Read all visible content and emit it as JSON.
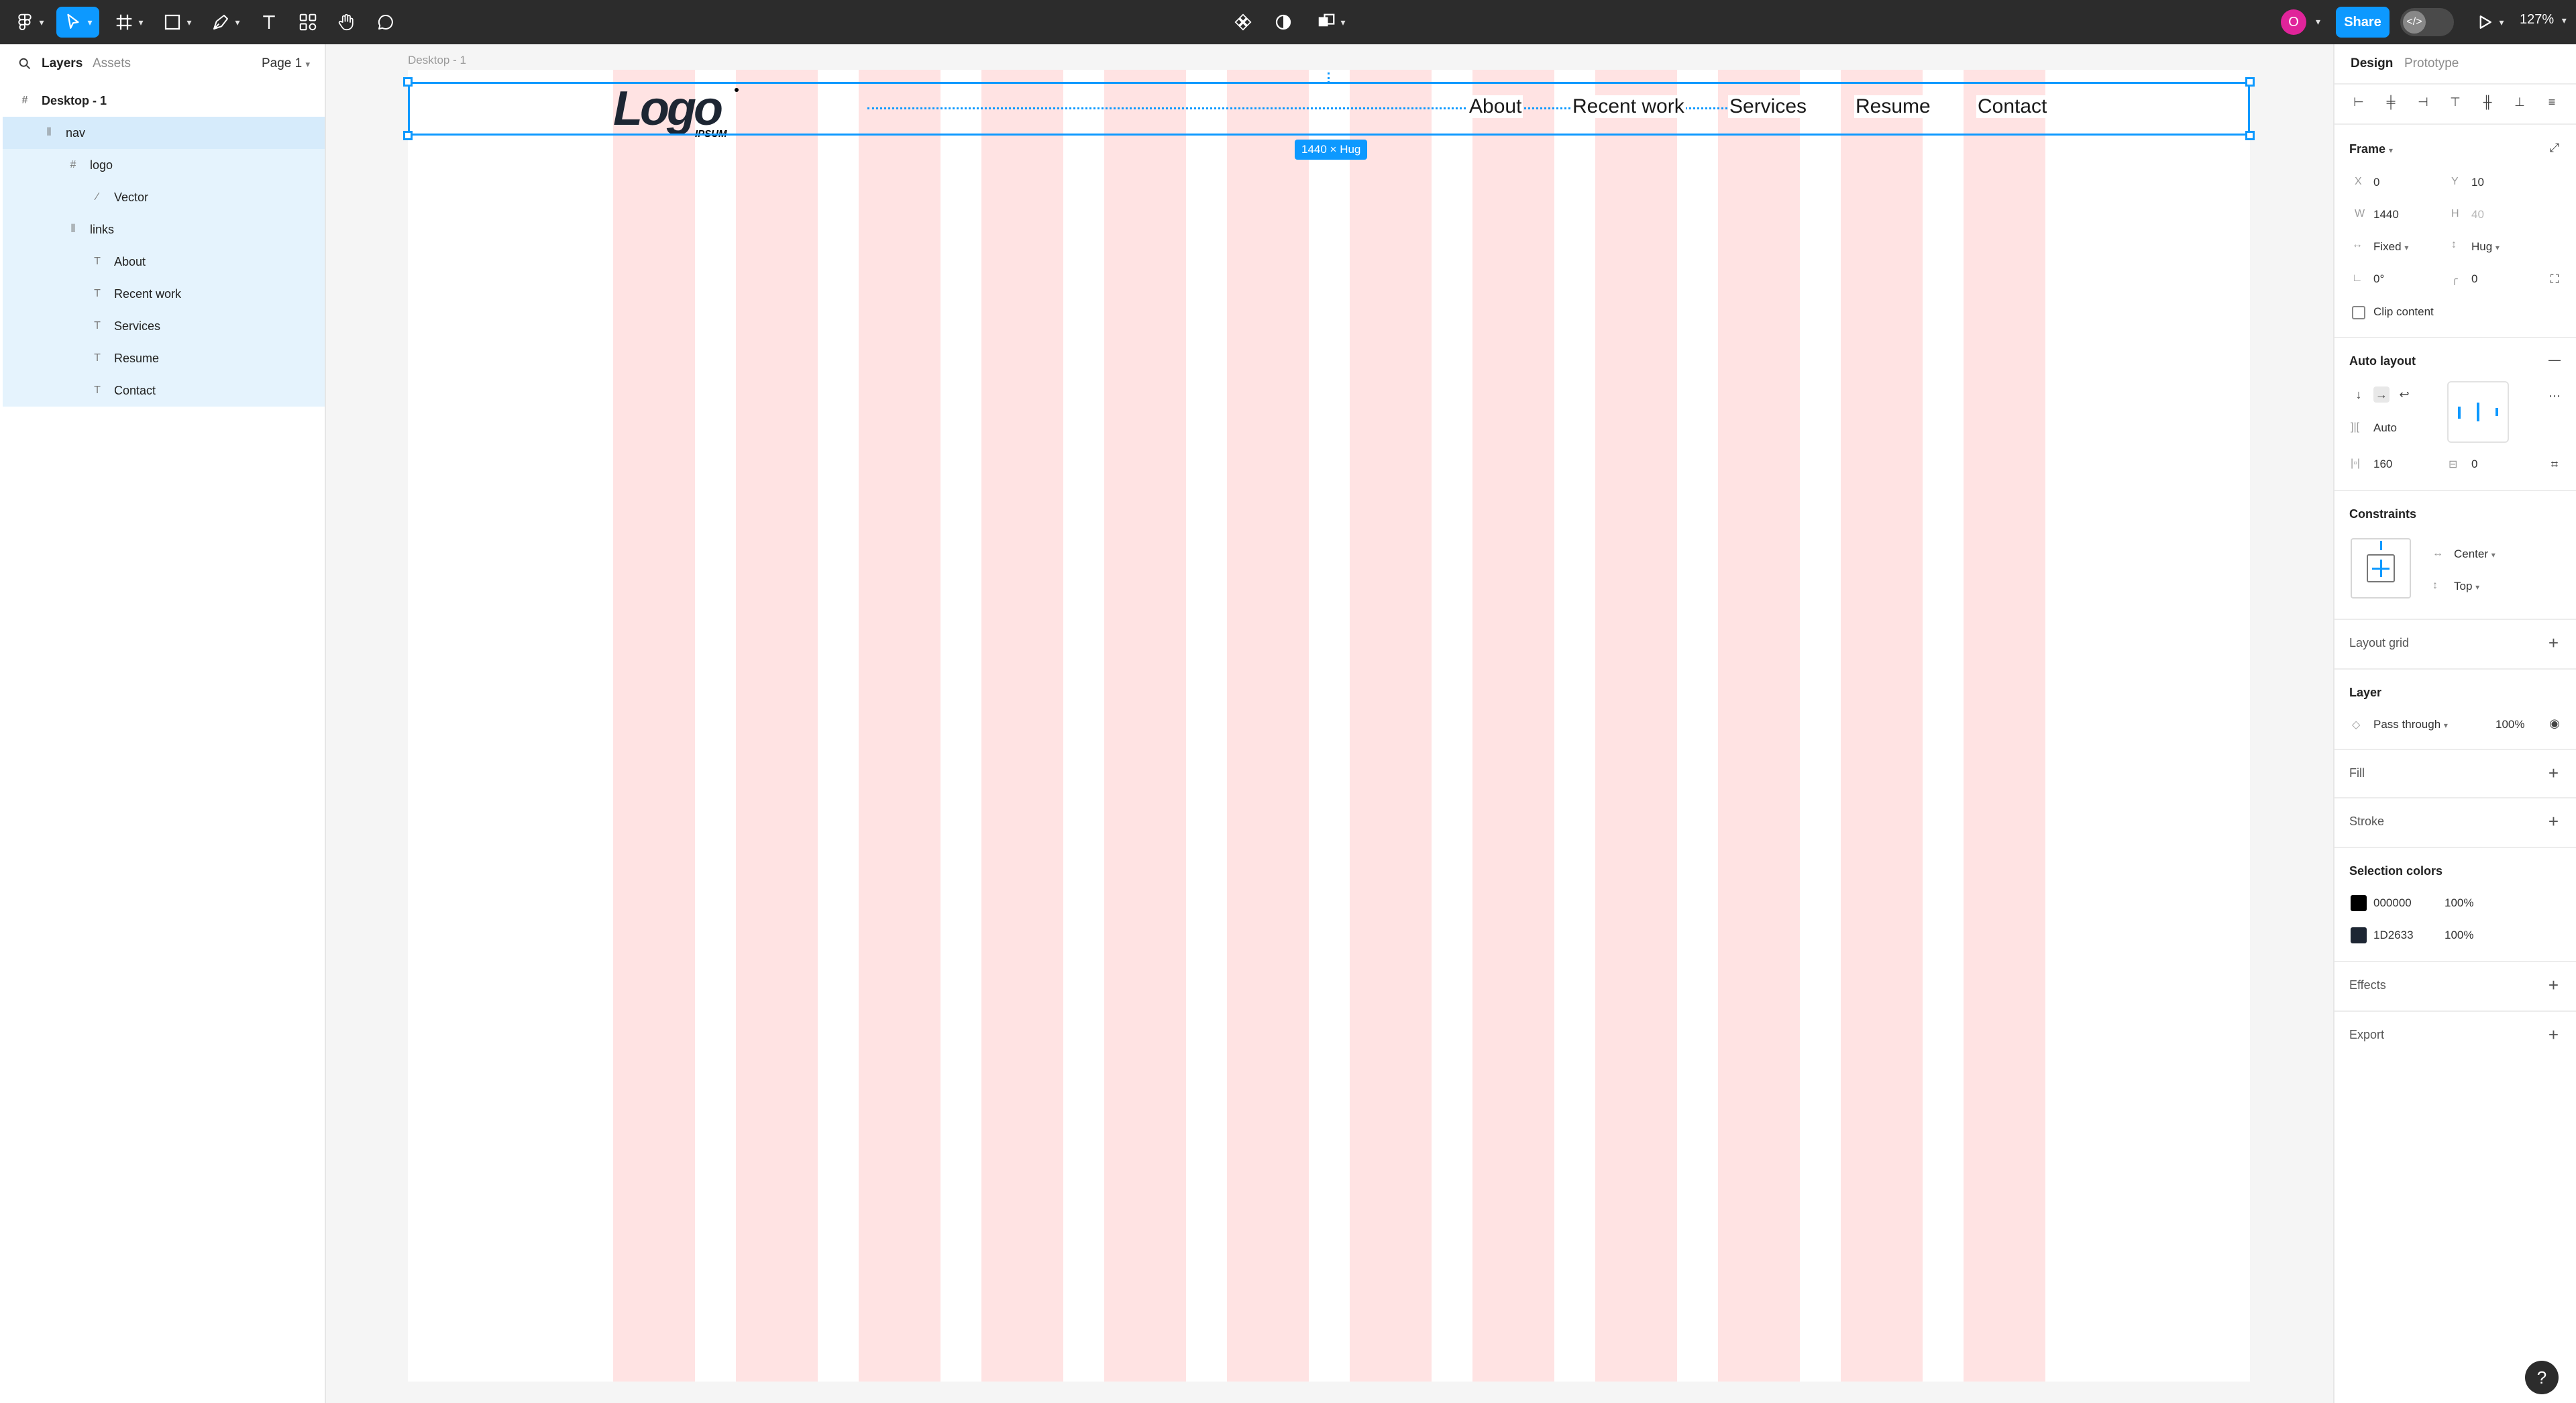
{
  "toolbar": {
    "share_label": "Share",
    "zoom_label": "127%",
    "avatar_initial": "O",
    "dev_mode_label": "</>"
  },
  "layers_panel": {
    "tab_layers": "Layers",
    "tab_assets": "Assets",
    "page_label": "Page 1",
    "layers": [
      {
        "name": "Desktop - 1",
        "icon": "frame-icon"
      },
      {
        "name": "nav",
        "icon": "auto-layout-icon"
      },
      {
        "name": "logo",
        "icon": "frame-icon"
      },
      {
        "name": "Vector",
        "icon": "vector-icon"
      },
      {
        "name": "links",
        "icon": "auto-layout-icon"
      },
      {
        "name": "About",
        "icon": "text-icon"
      },
      {
        "name": "Recent work",
        "icon": "text-icon"
      },
      {
        "name": "Services",
        "icon": "text-icon"
      },
      {
        "name": "Resume",
        "icon": "text-icon"
      },
      {
        "name": "Contact",
        "icon": "text-icon"
      }
    ]
  },
  "canvas": {
    "frame_label": "Desktop - 1",
    "size_badge": "1440 × Hug",
    "nav_links": [
      "About",
      "Recent work",
      "Services",
      "Resume",
      "Contact"
    ],
    "logo_text": "Logo",
    "logo_subtext": "IPSUM",
    "grid_color": "#ffe3e3",
    "selection_color": "#0d99ff"
  },
  "design_panel": {
    "tab_design": "Design",
    "tab_prototype": "Prototype",
    "frame_title": "Frame",
    "x_label": "X",
    "x_value": "0",
    "y_label": "Y",
    "y_value": "10",
    "w_label": "W",
    "w_value": "1440",
    "h_label": "H",
    "h_value": "40",
    "width_mode": "Fixed",
    "height_mode": "Hug",
    "rotation": "0°",
    "corner_radius": "0",
    "clip_content": "Clip content",
    "auto_layout_title": "Auto layout",
    "spacing_mode": "Auto",
    "horizontal_padding": "160",
    "vertical_padding": "0",
    "constraints_title": "Constraints",
    "constraint_h": "Center",
    "constraint_v": "Top",
    "layout_grid_title": "Layout grid",
    "layer_title": "Layer",
    "blend_mode": "Pass through",
    "opacity": "100%",
    "fill_title": "Fill",
    "stroke_title": "Stroke",
    "selection_colors_title": "Selection colors",
    "selection_colors": [
      {
        "hex": "000000",
        "opacity": "100%",
        "swatch": "#000000"
      },
      {
        "hex": "1D2633",
        "opacity": "100%",
        "swatch": "#1d2633"
      }
    ],
    "effects_title": "Effects",
    "export_title": "Export"
  }
}
